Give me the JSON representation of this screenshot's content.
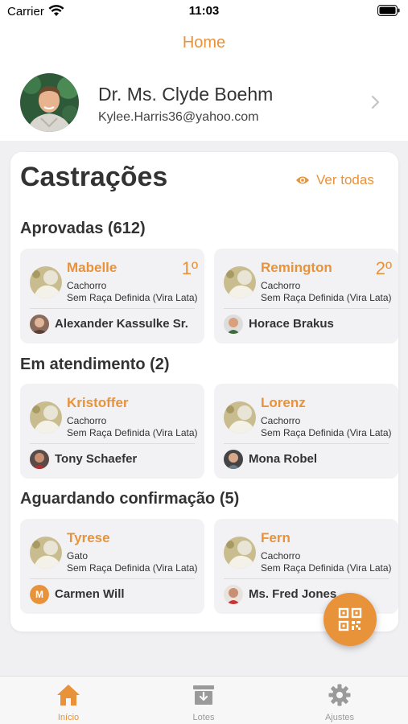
{
  "status_bar": {
    "carrier": "Carrier",
    "time": "11:03"
  },
  "nav": {
    "title": "Home"
  },
  "profile": {
    "name": "Dr. Ms. Clyde Boehm",
    "email": "Kylee.Harris36@yahoo.com"
  },
  "card": {
    "title": "Castrações",
    "view_all_label": "Ver todas"
  },
  "sections": [
    {
      "title": "Aprovadas (612)",
      "tiles": [
        {
          "pet_name": "Mabelle",
          "rank": "1º",
          "species": "Cachorro",
          "breed": "Sem Raça Definida (Vira Lata)",
          "owner": "Alexander Kassulke Sr."
        },
        {
          "pet_name": "Remington",
          "rank": "2º",
          "species": "Cachorro",
          "breed": "Sem Raça Definida (Vira Lata)",
          "owner": "Horace Brakus"
        }
      ]
    },
    {
      "title": "Em atendimento (2)",
      "tiles": [
        {
          "pet_name": "Kristoffer",
          "species": "Cachorro",
          "breed": "Sem Raça Definida (Vira Lata)",
          "owner": "Tony Schaefer"
        },
        {
          "pet_name": "Lorenz",
          "species": "Cachorro",
          "breed": "Sem Raça Definida (Vira Lata)",
          "owner": "Mona Robel"
        }
      ]
    },
    {
      "title": "Aguardando confirmação (5)",
      "tiles": [
        {
          "pet_name": "Tyrese",
          "species": "Gato",
          "breed": "Sem Raça Definida (Vira Lata)",
          "owner": "Carmen Will",
          "owner_initial": "M"
        },
        {
          "pet_name": "Fern",
          "species": "Cachorro",
          "breed": "Sem Raça Definida (Vira Lata)",
          "owner": "Ms. Fred Jones"
        }
      ]
    }
  ],
  "tabs": [
    {
      "label": "Início",
      "icon": "home-icon",
      "active": true
    },
    {
      "label": "Lotes",
      "icon": "archive-icon",
      "active": false
    },
    {
      "label": "Ajustes",
      "icon": "gear-icon",
      "active": false
    }
  ],
  "colors": {
    "accent": "#e8923a",
    "background": "#f0f0f3",
    "tile": "#f2f2f5"
  }
}
